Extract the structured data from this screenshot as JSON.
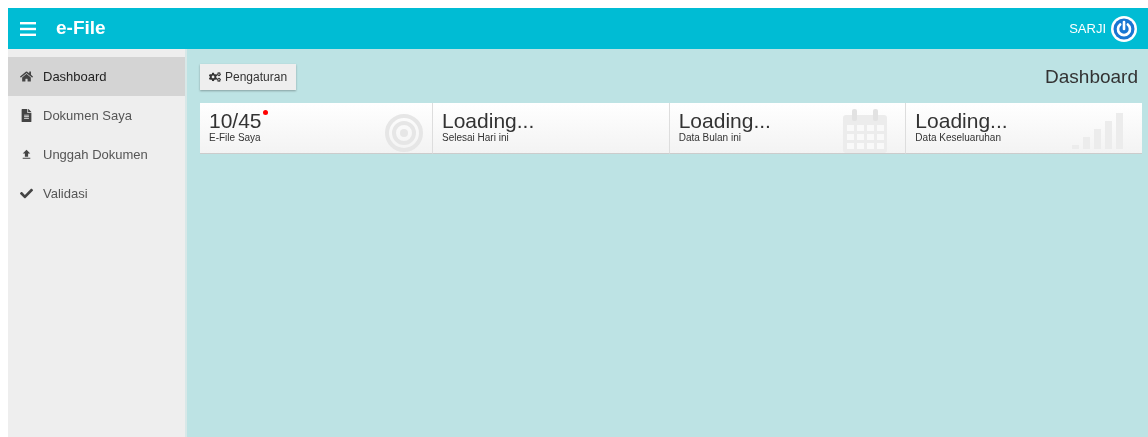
{
  "header": {
    "title": "e-File",
    "user": "SARJI"
  },
  "sidebar": {
    "items": [
      {
        "label": "Dashboard",
        "kind": "home",
        "selected": true
      },
      {
        "label": "Dokumen Saya",
        "kind": "file",
        "selected": false
      },
      {
        "label": "Unggah Dokumen",
        "kind": "upload",
        "selected": false
      },
      {
        "label": "Validasi",
        "kind": "check",
        "selected": false
      }
    ]
  },
  "toolbar": {
    "button": "Pengaturan",
    "page_title": "Dashboard"
  },
  "stats": [
    {
      "value": "10/45",
      "label": "E-File Saya",
      "alert": true,
      "kind": "target"
    },
    {
      "value": "Loading...",
      "label": "Selesai Hari ini",
      "alert": false,
      "kind": "plain"
    },
    {
      "value": "Loading...",
      "label": "Data Bulan ini",
      "alert": false,
      "kind": "calendar"
    },
    {
      "value": "Loading...",
      "label": "Data Keseluaruhan",
      "alert": false,
      "kind": "bars"
    }
  ]
}
